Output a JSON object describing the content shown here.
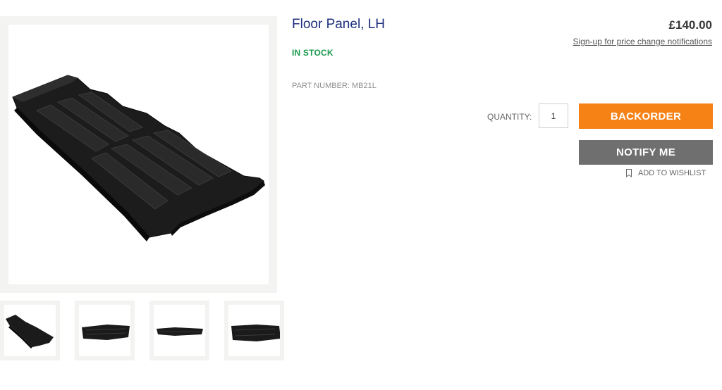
{
  "product": {
    "title": "Floor Panel, LH",
    "stock_status": "IN STOCK",
    "part_number_label": "PART NUMBER:",
    "part_number": "MB21L",
    "price": "£140.00",
    "price_notify_link": "Sign-up for price change notifications"
  },
  "purchase": {
    "quantity_label": "QUANTITY:",
    "quantity_value": "1",
    "backorder_label": "BACKORDER",
    "notify_label": "NOTIFY ME",
    "wishlist_label": "ADD TO WISHLIST",
    "wishlist_icon": "bookmark-icon"
  },
  "gallery": {
    "thumbnail_count": 4,
    "thumbnails": [
      "floor-panel-angle",
      "floor-panel-side",
      "floor-panel-profile",
      "floor-panel-end"
    ]
  },
  "colors": {
    "title": "#1e2f7f",
    "in_stock": "#1c9a4d",
    "backorder_button": "#f68216",
    "notify_button": "#6f6f6f"
  }
}
